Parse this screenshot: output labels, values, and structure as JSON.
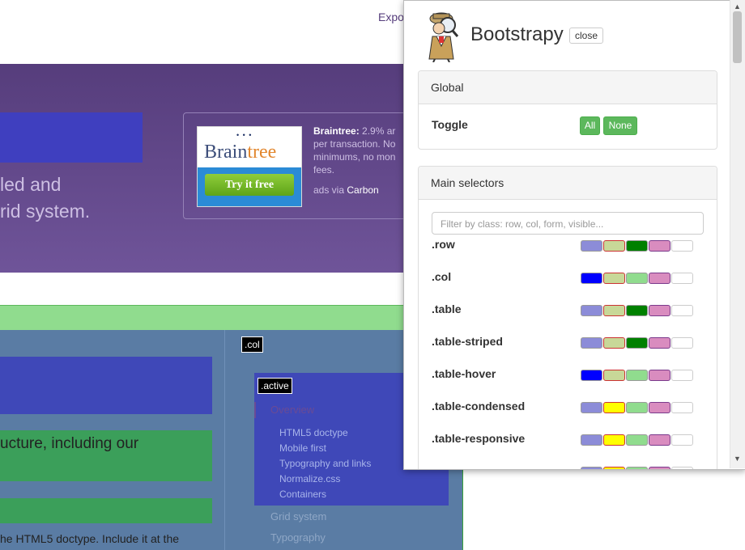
{
  "background": {
    "export_link": "Expo",
    "hero_text_line1": "led and",
    "hero_text_line2": "rid system.",
    "ad": {
      "logo_main": "Brain",
      "logo_accent": "tree",
      "button": "Try it free",
      "brand": "Braintree:",
      "desc_line1": " 2.9% ar",
      "desc_line2": "per transaction. No",
      "desc_line3": "minimums, no mon",
      "desc_line4": "fees.",
      "via": "ads via ",
      "via_brand": "Carbon"
    },
    "content_text1": "ucture, including our",
    "content_text2": "he HTML5 doctype. Include it at the",
    "col_tag": ".col",
    "active_tag": ".active",
    "nav": {
      "overview": "Overview",
      "sub_items": [
        "HTML5 doctype",
        "Mobile first",
        "Typography and links",
        "Normalize.css",
        "Containers"
      ],
      "grid_system": "Grid system",
      "typography": "Typography"
    }
  },
  "panel": {
    "title": "Bootstrapy",
    "close_label": "close",
    "global": {
      "heading": "Global",
      "toggle_label": "Toggle",
      "all_label": "All",
      "none_label": "None"
    },
    "main_selectors": {
      "heading": "Main selectors",
      "filter_placeholder": "Filter by class: row, col, form, visible...",
      "rows": [
        {
          "label": ".row",
          "colors": [
            "#8c8cd8",
            "#c8d898",
            "#008000",
            "#d98cbf",
            "#ffffff"
          ]
        },
        {
          "label": ".col",
          "colors": [
            "#0000ff",
            "#c8d898",
            "#90dc8e",
            "#d98cbf",
            "#ffffff"
          ]
        },
        {
          "label": ".table",
          "colors": [
            "#8c8cd8",
            "#c8d898",
            "#008000",
            "#d98cbf",
            "#ffffff"
          ]
        },
        {
          "label": ".table-striped",
          "colors": [
            "#8c8cd8",
            "#c8d898",
            "#008000",
            "#d98cbf",
            "#ffffff"
          ]
        },
        {
          "label": ".table-hover",
          "colors": [
            "#0000ff",
            "#c8d898",
            "#90dc8e",
            "#d98cbf",
            "#ffffff"
          ]
        },
        {
          "label": ".table-condensed",
          "colors": [
            "#8c8cd8",
            "#ffff00",
            "#90dc8e",
            "#d98cbf",
            "#ffffff"
          ]
        },
        {
          "label": ".table-responsive",
          "colors": [
            "#8c8cd8",
            "#ffff00",
            "#90dc8e",
            "#d98cbf",
            "#ffffff"
          ]
        },
        {
          "label": "",
          "colors": [
            "#8c8cd8",
            "#ffff00",
            "#90dc8e",
            "#d98cbf",
            "#ffffff"
          ]
        }
      ]
    }
  },
  "colors": {
    "accent_green": "#5cb85c",
    "hero_purple": "#563d7c"
  },
  "icons": {
    "logo": "detective-magnifier-icon",
    "scroll_up": "scroll-up-arrow-icon",
    "scroll_down": "scroll-down-arrow-icon"
  }
}
